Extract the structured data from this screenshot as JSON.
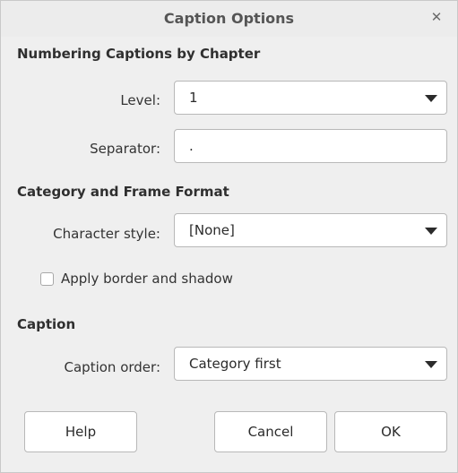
{
  "window": {
    "title": "Caption Options",
    "close_icon": "close-icon"
  },
  "numbering": {
    "heading": "Numbering Captions by Chapter",
    "level_label": "Level:",
    "level_value": "1",
    "separator_label": "Separator:",
    "separator_value": "."
  },
  "category_frame": {
    "heading": "Category and Frame Format",
    "char_style_label": "Character style:",
    "char_style_value": "[None]",
    "border_shadow_label": "Apply border and shadow",
    "border_shadow_checked": false
  },
  "caption": {
    "heading": "Caption",
    "order_label": "Caption order:",
    "order_value": "Category first"
  },
  "buttons": {
    "help": "Help",
    "cancel": "Cancel",
    "ok": "OK"
  },
  "colors": {
    "dialog_bg": "#efefef",
    "field_bg": "#ffffff",
    "border": "#b8b8b8"
  }
}
